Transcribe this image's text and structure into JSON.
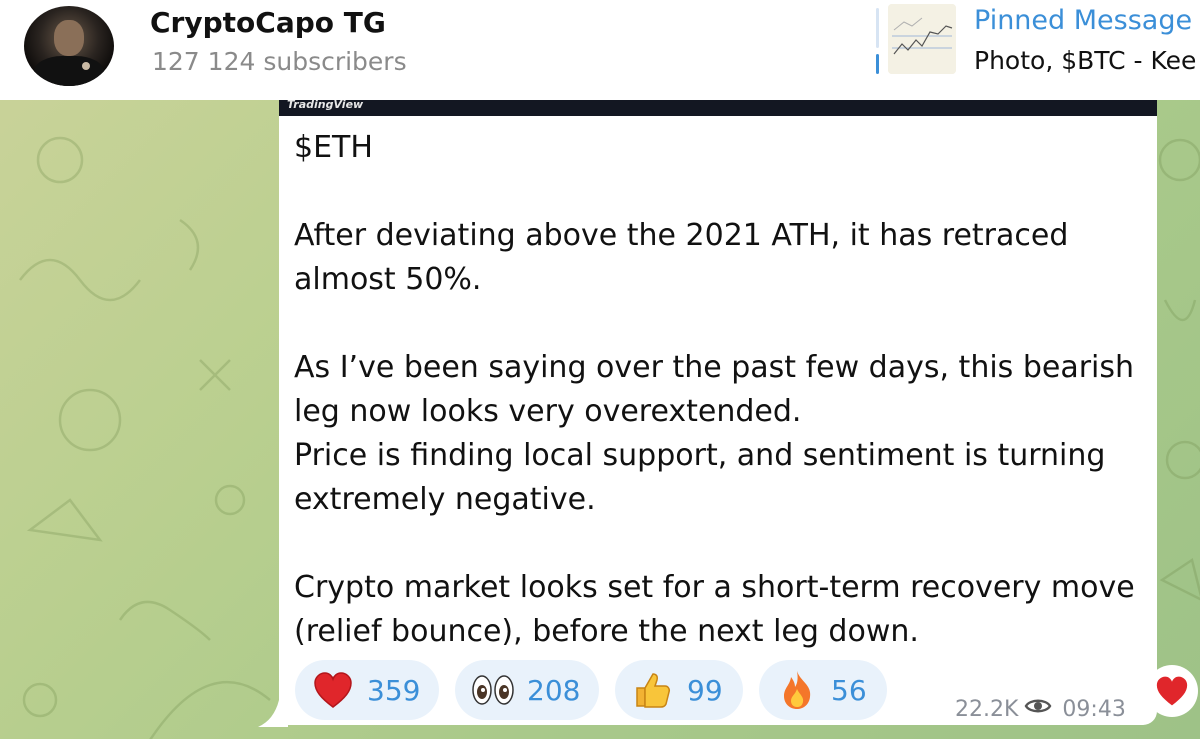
{
  "header": {
    "channel_name": "CryptoCapo TG",
    "subscribers": "127 124 subscribers",
    "pinned": {
      "title": "Pinned Message",
      "preview": "Photo, $BTC - Kee"
    }
  },
  "message": {
    "image_source": "TradingView",
    "paragraphs": [
      "$ETH",
      "",
      "After deviating above the 2021 ATH, it has retraced almost 50%.",
      "",
      "As I’ve been saying over the past few days, this bearish leg now looks very overextended.",
      "Price is finding local support, and sentiment is turning extremely negative.",
      "",
      "Crypto market looks set for a short-term recovery move (relief bounce), before the next leg down."
    ],
    "reactions": [
      {
        "emoji": "red-heart",
        "count": "359"
      },
      {
        "emoji": "eyes",
        "count": "208"
      },
      {
        "emoji": "thumbs-up",
        "count": "99"
      },
      {
        "emoji": "fire",
        "count": "56"
      }
    ],
    "views": "22.2K",
    "time": "09:43"
  },
  "colors": {
    "accent": "#3b8fd8",
    "reaction_bg": "#e9f2fb",
    "heart": "#e0262b"
  }
}
